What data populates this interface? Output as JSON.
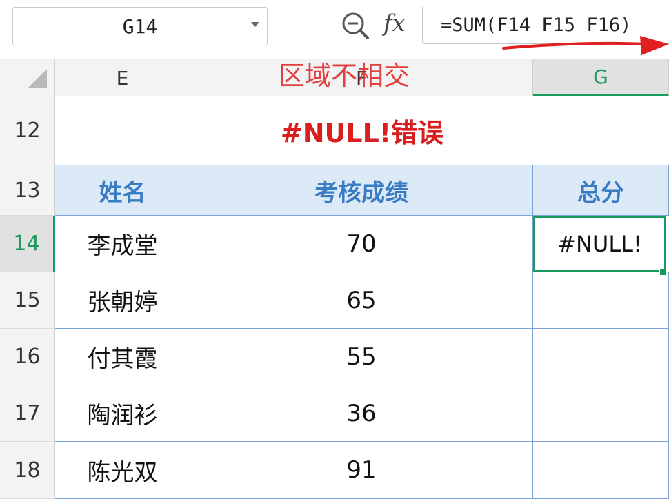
{
  "formula_bar": {
    "name_box": "G14",
    "fx_label": "fx",
    "formula": "=SUM(F14 F15 F16)"
  },
  "annotation": "区域不相交",
  "columns": [
    "E",
    "F",
    "G"
  ],
  "rows": [
    "12",
    "13",
    "14",
    "15",
    "16",
    "17",
    "18"
  ],
  "title": "#NULL!错误",
  "headers": [
    "姓名",
    "考核成绩",
    "总分"
  ],
  "records": [
    {
      "name": "李成堂",
      "score": "70",
      "total": "#NULL!"
    },
    {
      "name": "张朝婷",
      "score": "65",
      "total": ""
    },
    {
      "name": "付其霞",
      "score": "55",
      "total": ""
    },
    {
      "name": "陶润衫",
      "score": "36",
      "total": ""
    },
    {
      "name": "陈光双",
      "score": "91",
      "total": ""
    }
  ],
  "colors": {
    "accent_green": "#1a9a5c",
    "title_red": "#d81e1e",
    "header_blue": "#3a7cc4",
    "header_bg": "#dce9f7",
    "arrow_red": "#e02020"
  },
  "icons": [
    "zoom-formula-icon",
    "fx-icon",
    "dropdown-caret-icon",
    "select-all-triangle-icon",
    "annotation-arrow"
  ]
}
